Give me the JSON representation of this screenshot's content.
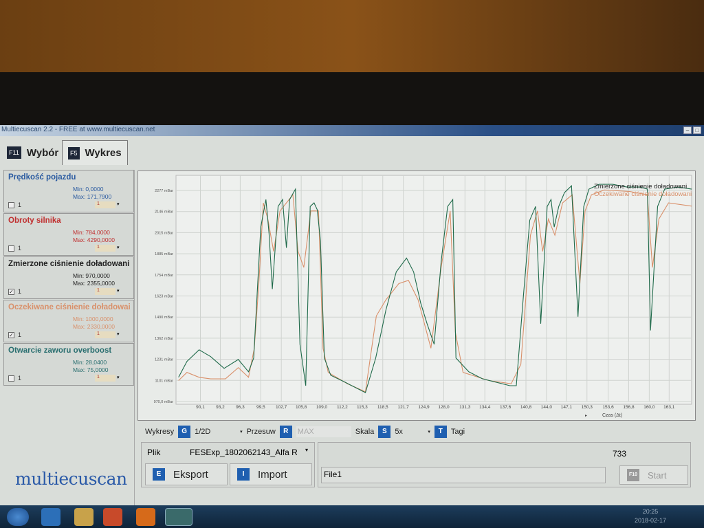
{
  "window": {
    "title": "Multiecuscan 2.2 - FREE at www.multiecuscan.net"
  },
  "tabs": [
    {
      "key": "F11",
      "label": "Wybór"
    },
    {
      "key": "F5",
      "label": "Wykres"
    }
  ],
  "sensors": [
    {
      "name": "Prędkość pojazdu",
      "min": "Min: 0,0000",
      "max": "Max: 171,7900",
      "checked": false,
      "axis": "1",
      "color": "#2a5aa0"
    },
    {
      "name": "Obroty silnika",
      "min": "Min: 784,0000",
      "max": "Max: 4290,0000",
      "checked": false,
      "axis": "1",
      "color": "#c03030"
    },
    {
      "name": "Zmierzone ciśnienie doładowani",
      "min": "Min: 970,0000",
      "max": "Max: 2355,0000",
      "checked": true,
      "axis": "1",
      "color": "#222222"
    },
    {
      "name": "Oczekiwane ciśnienie doładowai",
      "min": "Min: 1000,0000",
      "max": "Max: 2330,0000",
      "checked": true,
      "axis": "1",
      "color": "#d9906a"
    },
    {
      "name": "Otwarcie zaworu overboost",
      "min": "Min: 28,0400",
      "max": "Max: 75,0000",
      "checked": false,
      "axis": "1",
      "color": "#2a6f70"
    }
  ],
  "checkbox_label": "1",
  "logo": "multiecuscan",
  "chart_data": {
    "type": "line",
    "xlabel": "Czas (Δt)",
    "x_ticks": [
      "90,1",
      "93,2",
      "96,3",
      "99,5",
      "102,7",
      "105,8",
      "109,0",
      "112,2",
      "115,3",
      "118,5",
      "121,7",
      "124,9",
      "128,0",
      "131,3",
      "134,4",
      "137,6",
      "140,8",
      "144,0",
      "147,1",
      "150,3",
      "153,6",
      "156,8",
      "160,0",
      "163,1"
    ],
    "y_ticks": [
      "2277 mBar",
      "2146 mBar",
      "2015 mBar",
      "1885 mBar",
      "1754 mBar",
      "1623 mBar",
      "1490 mBar",
      "1362 mBar",
      "1231 mBar",
      "1101 mBar",
      "970,0 mBar"
    ],
    "xlim": [
      86.3,
      166.6
    ],
    "ylim": [
      970,
      2277
    ],
    "legend": "top-right",
    "series": [
      {
        "name": "Zmierzone ciśnienie doładowani",
        "color": "#1f6a4a",
        "points": [
          [
            86.7,
            1120
          ],
          [
            88,
            1218
          ],
          [
            89.9,
            1290
          ],
          [
            91.7,
            1248
          ],
          [
            93.8,
            1175
          ],
          [
            96,
            1230
          ],
          [
            97.6,
            1154
          ],
          [
            98.4,
            1239
          ],
          [
            99.5,
            2050
          ],
          [
            100.3,
            2221
          ],
          [
            100.8,
            2008
          ],
          [
            101.3,
            1666
          ],
          [
            102.2,
            2178
          ],
          [
            102.9,
            2221
          ],
          [
            103.5,
            1922
          ],
          [
            104,
            2221
          ],
          [
            104.9,
            2285
          ],
          [
            105.6,
            1324
          ],
          [
            106.5,
            1068
          ],
          [
            107.2,
            2178
          ],
          [
            107.8,
            2200
          ],
          [
            108.3,
            2157
          ],
          [
            108.8,
            1965
          ],
          [
            109.4,
            1239
          ],
          [
            110.4,
            1132
          ],
          [
            112.6,
            1090
          ],
          [
            114.7,
            1047
          ],
          [
            115.8,
            1025
          ],
          [
            117.4,
            1239
          ],
          [
            119,
            1538
          ],
          [
            120.6,
            1773
          ],
          [
            122.2,
            1858
          ],
          [
            123.3,
            1773
          ],
          [
            124.4,
            1580
          ],
          [
            125.4,
            1452
          ],
          [
            126.5,
            1324
          ],
          [
            127.6,
            1837
          ],
          [
            128.6,
            2178
          ],
          [
            129.4,
            2221
          ],
          [
            129.9,
            1239
          ],
          [
            131.9,
            1154
          ],
          [
            134,
            1111
          ],
          [
            136.1,
            1090
          ],
          [
            138.3,
            1068
          ],
          [
            139.3,
            1068
          ],
          [
            140.4,
            1623
          ],
          [
            141.4,
            2093
          ],
          [
            142.3,
            2178
          ],
          [
            143.1,
            1452
          ],
          [
            144.1,
            2178
          ],
          [
            144.7,
            2221
          ],
          [
            145.2,
            2050
          ],
          [
            145.9,
            2178
          ],
          [
            146.8,
            2264
          ],
          [
            147.9,
            2306
          ],
          [
            148.9,
            1495
          ],
          [
            149.8,
            2178
          ],
          [
            150.6,
            2285
          ],
          [
            152.2,
            2315
          ],
          [
            154.3,
            2315
          ],
          [
            156.5,
            2298
          ],
          [
            158.6,
            2298
          ],
          [
            159.7,
            2285
          ],
          [
            160.2,
            1410
          ],
          [
            161.3,
            2178
          ],
          [
            162.4,
            2285
          ],
          [
            164.5,
            2298
          ],
          [
            166.6,
            2285
          ]
        ]
      },
      {
        "name": "Oczekiwane ciśnienie doładowani",
        "color": "#d9906a",
        "points": [
          [
            86.7,
            1100
          ],
          [
            88,
            1150
          ],
          [
            89.9,
            1120
          ],
          [
            91.7,
            1110
          ],
          [
            94,
            1110
          ],
          [
            96,
            1180
          ],
          [
            97.6,
            1120
          ],
          [
            98.5,
            1300
          ],
          [
            99.2,
            1700
          ],
          [
            99.9,
            2200
          ],
          [
            100.6,
            2100
          ],
          [
            101.5,
            1900
          ],
          [
            102.5,
            2150
          ],
          [
            103.5,
            2200
          ],
          [
            104.5,
            2250
          ],
          [
            105.3,
            1900
          ],
          [
            106.2,
            1800
          ],
          [
            107.3,
            2150
          ],
          [
            108.5,
            2150
          ],
          [
            109.2,
            1300
          ],
          [
            110,
            1150
          ],
          [
            113,
            1080
          ],
          [
            115.8,
            1030
          ],
          [
            117.5,
            1500
          ],
          [
            119,
            1600
          ],
          [
            121,
            1700
          ],
          [
            122.5,
            1720
          ],
          [
            124,
            1600
          ],
          [
            126,
            1300
          ],
          [
            127.6,
            1800
          ],
          [
            129,
            2150
          ],
          [
            129.8,
            1400
          ],
          [
            131,
            1150
          ],
          [
            135,
            1100
          ],
          [
            138.5,
            1080
          ],
          [
            140,
            1200
          ],
          [
            141.5,
            2000
          ],
          [
            142.6,
            2150
          ],
          [
            143.4,
            1900
          ],
          [
            144.3,
            2100
          ],
          [
            145.3,
            2000
          ],
          [
            146.5,
            2200
          ],
          [
            148,
            2250
          ],
          [
            149.2,
            1700
          ],
          [
            150,
            2150
          ],
          [
            151,
            2250
          ],
          [
            153,
            2280
          ],
          [
            157,
            2270
          ],
          [
            159.7,
            2250
          ],
          [
            160.5,
            1800
          ],
          [
            161.5,
            2100
          ],
          [
            163,
            2200
          ],
          [
            166.6,
            2180
          ]
        ]
      }
    ]
  },
  "controls": {
    "wykresy_label": "Wykresy",
    "wykresy_key": "G",
    "wykresy_value": "1/2D",
    "przesuw_label": "Przesuw",
    "przesuw_key": "R",
    "przesuw_value": "MAX",
    "skala_label": "Skala",
    "skala_key": "S",
    "skala_value": "5x",
    "tagi_key": "T",
    "tagi_label": "Tagi"
  },
  "file": {
    "label": "Plik",
    "value": "FESExp_1802062143_Alfa R",
    "export_key": "E",
    "export_label": "Eksport",
    "import_key": "I",
    "import_label": "Import"
  },
  "run": {
    "count": "733",
    "filename": "File1",
    "start_key": "F10",
    "start_label": "Start"
  },
  "taskbar": {
    "time": "20:25",
    "date": "2018-02-17"
  }
}
